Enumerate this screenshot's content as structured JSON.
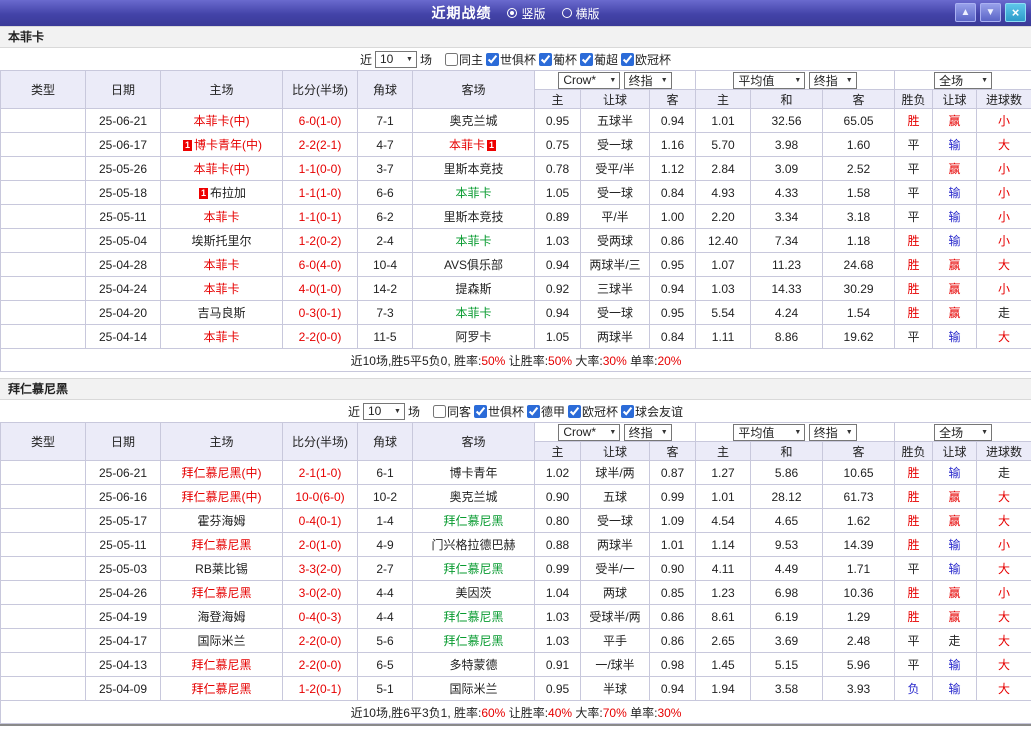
{
  "titlebar": {
    "title": "近期战绩",
    "vertical_label": "竖版",
    "horizontal_label": "横版",
    "orientation_selected": "竖版"
  },
  "icons": {
    "chevron_down": "▼",
    "up": "▲",
    "down": "▼",
    "close": "×"
  },
  "colors": {
    "accent_bar": "#4343a8",
    "win": "#e60000",
    "lose": "#2929cc",
    "home_team": "#e60000",
    "away_team": "#089b30"
  },
  "columns": [
    "类型",
    "日期",
    "主场",
    "比分(半场)",
    "角球",
    "客场",
    "主",
    "让球",
    "客",
    "主",
    "和",
    "客",
    "胜负",
    "让球",
    "进球数"
  ],
  "dropdowns": {
    "company": "Crow*",
    "final": "终指",
    "average": "平均值",
    "scope": "全场"
  },
  "sections": [
    {
      "team": "本菲卡",
      "filter": {
        "prefix": "近",
        "count": "10",
        "suffix": "场",
        "same": {
          "label": "同主",
          "checked": false
        },
        "comps": [
          {
            "label": "世俱杯",
            "checked": true
          },
          {
            "label": "葡杯",
            "checked": true
          },
          {
            "label": "葡超",
            "checked": true
          },
          {
            "label": "欧冠杯",
            "checked": true
          }
        ]
      },
      "rows": [
        {
          "comp": "世俱杯",
          "cc": "gold",
          "date": "25-06-21",
          "home": "本菲卡(中)",
          "hc": "r",
          "hcard": "",
          "score": "6-0(1-0)",
          "corner": "7-1",
          "away": "奥克兰城",
          "ac": "k",
          "acard": "",
          "o1": "0.95",
          "hcap": "五球半",
          "o2": "0.94",
          "e1": "1.01",
          "e2": "32.56",
          "e3": "65.05",
          "r1": "胜",
          "r1c": "r",
          "r2": "赢",
          "r2c": "r",
          "r3": "小",
          "r3c": "r"
        },
        {
          "comp": "世俱杯",
          "cc": "gold",
          "date": "25-06-17",
          "home": "博卡青年(中)",
          "hc": "r",
          "hcard": "1",
          "score": "2-2(2-1)",
          "corner": "4-7",
          "away": "本菲卡",
          "ac": "r",
          "acard": "1",
          "o1": "0.75",
          "hcap": "受一球",
          "o2": "1.16",
          "e1": "5.70",
          "e2": "3.98",
          "e3": "1.60",
          "r1": "平",
          "r1c": "k",
          "r2": "输",
          "r2c": "b",
          "r3": "大",
          "r3c": "r"
        },
        {
          "comp": "葡杯",
          "cc": "green",
          "date": "25-05-26",
          "home": "本菲卡(中)",
          "hc": "r",
          "hcard": "",
          "score": "1-1(0-0)",
          "corner": "3-7",
          "away": "里斯本竞技",
          "ac": "k",
          "acard": "",
          "o1": "0.78",
          "hcap": "受平/半",
          "o2": "1.12",
          "e1": "2.84",
          "e2": "3.09",
          "e3": "2.52",
          "r1": "平",
          "r1c": "k",
          "r2": "赢",
          "r2c": "r",
          "r3": "小",
          "r3c": "r"
        },
        {
          "comp": "葡超",
          "cc": "teal",
          "date": "25-05-18",
          "home": "布拉加",
          "hc": "k",
          "hcard": "1",
          "score": "1-1(1-0)",
          "corner": "6-6",
          "away": "本菲卡",
          "ac": "g",
          "acard": "",
          "o1": "1.05",
          "hcap": "受一球",
          "o2": "0.84",
          "e1": "4.93",
          "e2": "4.33",
          "e3": "1.58",
          "r1": "平",
          "r1c": "k",
          "r2": "输",
          "r2c": "b",
          "r3": "小",
          "r3c": "r"
        },
        {
          "comp": "葡超",
          "cc": "teal",
          "date": "25-05-11",
          "home": "本菲卡",
          "hc": "r",
          "hcard": "",
          "score": "1-1(0-1)",
          "corner": "6-2",
          "away": "里斯本竞技",
          "ac": "k",
          "acard": "",
          "o1": "0.89",
          "hcap": "平/半",
          "o2": "1.00",
          "e1": "2.20",
          "e2": "3.34",
          "e3": "3.18",
          "r1": "平",
          "r1c": "k",
          "r2": "输",
          "r2c": "b",
          "r3": "小",
          "r3c": "r"
        },
        {
          "comp": "葡超",
          "cc": "teal",
          "date": "25-05-04",
          "home": "埃斯托里尔",
          "hc": "k",
          "hcard": "",
          "score": "1-2(0-2)",
          "corner": "2-4",
          "away": "本菲卡",
          "ac": "g",
          "acard": "",
          "o1": "1.03",
          "hcap": "受两球",
          "o2": "0.86",
          "e1": "12.40",
          "e2": "7.34",
          "e3": "1.18",
          "r1": "胜",
          "r1c": "r",
          "r2": "输",
          "r2c": "b",
          "r3": "小",
          "r3c": "r"
        },
        {
          "comp": "葡超",
          "cc": "teal",
          "date": "25-04-28",
          "home": "本菲卡",
          "hc": "r",
          "hcard": "",
          "score": "6-0(4-0)",
          "corner": "10-4",
          "away": "AVS俱乐部",
          "ac": "k",
          "acard": "",
          "o1": "0.94",
          "hcap": "两球半/三",
          "o2": "0.95",
          "e1": "1.07",
          "e2": "11.23",
          "e3": "24.68",
          "r1": "胜",
          "r1c": "r",
          "r2": "赢",
          "r2c": "r",
          "r3": "大",
          "r3c": "r"
        },
        {
          "comp": "葡杯",
          "cc": "green",
          "date": "25-04-24",
          "home": "本菲卡",
          "hc": "r",
          "hcard": "",
          "score": "4-0(1-0)",
          "corner": "14-2",
          "away": "提森斯",
          "ac": "k",
          "acard": "",
          "o1": "0.92",
          "hcap": "三球半",
          "o2": "0.94",
          "e1": "1.03",
          "e2": "14.33",
          "e3": "30.29",
          "r1": "胜",
          "r1c": "r",
          "r2": "赢",
          "r2c": "r",
          "r3": "小",
          "r3c": "r"
        },
        {
          "comp": "葡超",
          "cc": "teal",
          "date": "25-04-20",
          "home": "吉马良斯",
          "hc": "k",
          "hcard": "",
          "score": "0-3(0-1)",
          "corner": "7-3",
          "away": "本菲卡",
          "ac": "g",
          "acard": "",
          "o1": "0.94",
          "hcap": "受一球",
          "o2": "0.95",
          "e1": "5.54",
          "e2": "4.24",
          "e3": "1.54",
          "r1": "胜",
          "r1c": "r",
          "r2": "赢",
          "r2c": "r",
          "r3": "走",
          "r3c": "k"
        },
        {
          "comp": "葡超",
          "cc": "teal",
          "date": "25-04-14",
          "home": "本菲卡",
          "hc": "r",
          "hcard": "",
          "score": "2-2(0-0)",
          "corner": "11-5",
          "away": "阿罗卡",
          "ac": "k",
          "acard": "",
          "o1": "1.05",
          "hcap": "两球半",
          "o2": "0.84",
          "e1": "1.11",
          "e2": "8.86",
          "e3": "19.62",
          "r1": "平",
          "r1c": "k",
          "r2": "输",
          "r2c": "b",
          "r3": "大",
          "r3c": "r"
        }
      ],
      "summary": [
        {
          "t": "近10场,胜5平5负0, 胜率:",
          "c": "k"
        },
        {
          "t": "50%",
          "c": "r"
        },
        {
          "t": " 让胜率:",
          "c": "k"
        },
        {
          "t": "50%",
          "c": "r"
        },
        {
          "t": " 大率:",
          "c": "k"
        },
        {
          "t": "30%",
          "c": "r"
        },
        {
          "t": " 单率:",
          "c": "k"
        },
        {
          "t": "20%",
          "c": "r"
        }
      ]
    },
    {
      "team": "拜仁慕尼黑",
      "filter": {
        "prefix": "近",
        "count": "10",
        "suffix": "场",
        "same": {
          "label": "同客",
          "checked": false
        },
        "comps": [
          {
            "label": "世俱杯",
            "checked": true
          },
          {
            "label": "德甲",
            "checked": true
          },
          {
            "label": "欧冠杯",
            "checked": true
          },
          {
            "label": "球会友谊",
            "checked": true
          }
        ]
      },
      "rows": [
        {
          "comp": "世俱杯",
          "cc": "gold",
          "date": "25-06-21",
          "home": "拜仁慕尼黑(中)",
          "hc": "r",
          "hcard": "",
          "score": "2-1(1-0)",
          "corner": "6-1",
          "away": "博卡青年",
          "ac": "k",
          "acard": "",
          "o1": "1.02",
          "hcap": "球半/两",
          "o2": "0.87",
          "e1": "1.27",
          "e2": "5.86",
          "e3": "10.65",
          "r1": "胜",
          "r1c": "r",
          "r2": "输",
          "r2c": "b",
          "r3": "走",
          "r3c": "k"
        },
        {
          "comp": "世俱杯",
          "cc": "gold",
          "date": "25-06-16",
          "home": "拜仁慕尼黑(中)",
          "hc": "r",
          "hcard": "",
          "score": "10-0(6-0)",
          "corner": "10-2",
          "away": "奥克兰城",
          "ac": "k",
          "acard": "",
          "o1": "0.90",
          "hcap": "五球",
          "o2": "0.99",
          "e1": "1.01",
          "e2": "28.12",
          "e3": "61.73",
          "r1": "胜",
          "r1c": "r",
          "r2": "赢",
          "r2c": "r",
          "r3": "大",
          "r3c": "r"
        },
        {
          "comp": "德甲",
          "cc": "red",
          "date": "25-05-17",
          "home": "霍芬海姆",
          "hc": "k",
          "hcard": "",
          "score": "0-4(0-1)",
          "corner": "1-4",
          "away": "拜仁慕尼黑",
          "ac": "g",
          "acard": "",
          "o1": "0.80",
          "hcap": "受一球",
          "o2": "1.09",
          "e1": "4.54",
          "e2": "4.65",
          "e3": "1.62",
          "r1": "胜",
          "r1c": "r",
          "r2": "赢",
          "r2c": "r",
          "r3": "大",
          "r3c": "r"
        },
        {
          "comp": "德甲",
          "cc": "red",
          "date": "25-05-11",
          "home": "拜仁慕尼黑",
          "hc": "r",
          "hcard": "",
          "score": "2-0(1-0)",
          "corner": "4-9",
          "away": "门兴格拉德巴赫",
          "ac": "k",
          "acard": "",
          "o1": "0.88",
          "hcap": "两球半",
          "o2": "1.01",
          "e1": "1.14",
          "e2": "9.53",
          "e3": "14.39",
          "r1": "胜",
          "r1c": "r",
          "r2": "输",
          "r2c": "b",
          "r3": "小",
          "r3c": "r"
        },
        {
          "comp": "德甲",
          "cc": "red",
          "date": "25-05-03",
          "home": "RB莱比锡",
          "hc": "k",
          "hcard": "",
          "score": "3-3(2-0)",
          "corner": "2-7",
          "away": "拜仁慕尼黑",
          "ac": "g",
          "acard": "",
          "o1": "0.99",
          "hcap": "受半/一",
          "o2": "0.90",
          "e1": "4.11",
          "e2": "4.49",
          "e3": "1.71",
          "r1": "平",
          "r1c": "k",
          "r2": "输",
          "r2c": "b",
          "r3": "大",
          "r3c": "r"
        },
        {
          "comp": "德甲",
          "cc": "red",
          "date": "25-04-26",
          "home": "拜仁慕尼黑",
          "hc": "r",
          "hcard": "",
          "score": "3-0(2-0)",
          "corner": "4-4",
          "away": "美因茨",
          "ac": "k",
          "acard": "",
          "o1": "1.04",
          "hcap": "两球",
          "o2": "0.85",
          "e1": "1.23",
          "e2": "6.98",
          "e3": "10.36",
          "r1": "胜",
          "r1c": "r",
          "r2": "赢",
          "r2c": "r",
          "r3": "小",
          "r3c": "r"
        },
        {
          "comp": "德甲",
          "cc": "red",
          "date": "25-04-19",
          "home": "海登海姆",
          "hc": "k",
          "hcard": "",
          "score": "0-4(0-3)",
          "corner": "4-4",
          "away": "拜仁慕尼黑",
          "ac": "g",
          "acard": "",
          "o1": "1.03",
          "hcap": "受球半/两",
          "o2": "0.86",
          "e1": "8.61",
          "e2": "6.19",
          "e3": "1.29",
          "r1": "胜",
          "r1c": "r",
          "r2": "赢",
          "r2c": "r",
          "r3": "大",
          "r3c": "r"
        },
        {
          "comp": "欧冠杯",
          "cc": "purple",
          "date": "25-04-17",
          "home": "国际米兰",
          "hc": "k",
          "hcard": "",
          "score": "2-2(0-0)",
          "corner": "5-6",
          "away": "拜仁慕尼黑",
          "ac": "g",
          "acard": "",
          "o1": "1.03",
          "hcap": "平手",
          "o2": "0.86",
          "e1": "2.65",
          "e2": "3.69",
          "e3": "2.48",
          "r1": "平",
          "r1c": "k",
          "r2": "走",
          "r2c": "k",
          "r3": "大",
          "r3c": "r"
        },
        {
          "comp": "德甲",
          "cc": "red",
          "date": "25-04-13",
          "home": "拜仁慕尼黑",
          "hc": "r",
          "hcard": "",
          "score": "2-2(0-0)",
          "corner": "6-5",
          "away": "多特蒙德",
          "ac": "k",
          "acard": "",
          "o1": "0.91",
          "hcap": "一/球半",
          "o2": "0.98",
          "e1": "1.45",
          "e2": "5.15",
          "e3": "5.96",
          "r1": "平",
          "r1c": "k",
          "r2": "输",
          "r2c": "b",
          "r3": "大",
          "r3c": "r"
        },
        {
          "comp": "欧冠杯",
          "cc": "purple",
          "date": "25-04-09",
          "home": "拜仁慕尼黑",
          "hc": "r",
          "hcard": "",
          "score": "1-2(0-1)",
          "corner": "5-1",
          "away": "国际米兰",
          "ac": "k",
          "acard": "",
          "o1": "0.95",
          "hcap": "半球",
          "o2": "0.94",
          "e1": "1.94",
          "e2": "3.58",
          "e3": "3.93",
          "r1": "负",
          "r1c": "b",
          "r2": "输",
          "r2c": "b",
          "r3": "大",
          "r3c": "r"
        }
      ],
      "summary": [
        {
          "t": "近10场,胜6平3负1, 胜率:",
          "c": "k"
        },
        {
          "t": "60%",
          "c": "r"
        },
        {
          "t": " 让胜率:",
          "c": "k"
        },
        {
          "t": "40%",
          "c": "r"
        },
        {
          "t": " 大率:",
          "c": "k"
        },
        {
          "t": "70%",
          "c": "r"
        },
        {
          "t": " 单率:",
          "c": "k"
        },
        {
          "t": "30%",
          "c": "r"
        }
      ]
    }
  ]
}
